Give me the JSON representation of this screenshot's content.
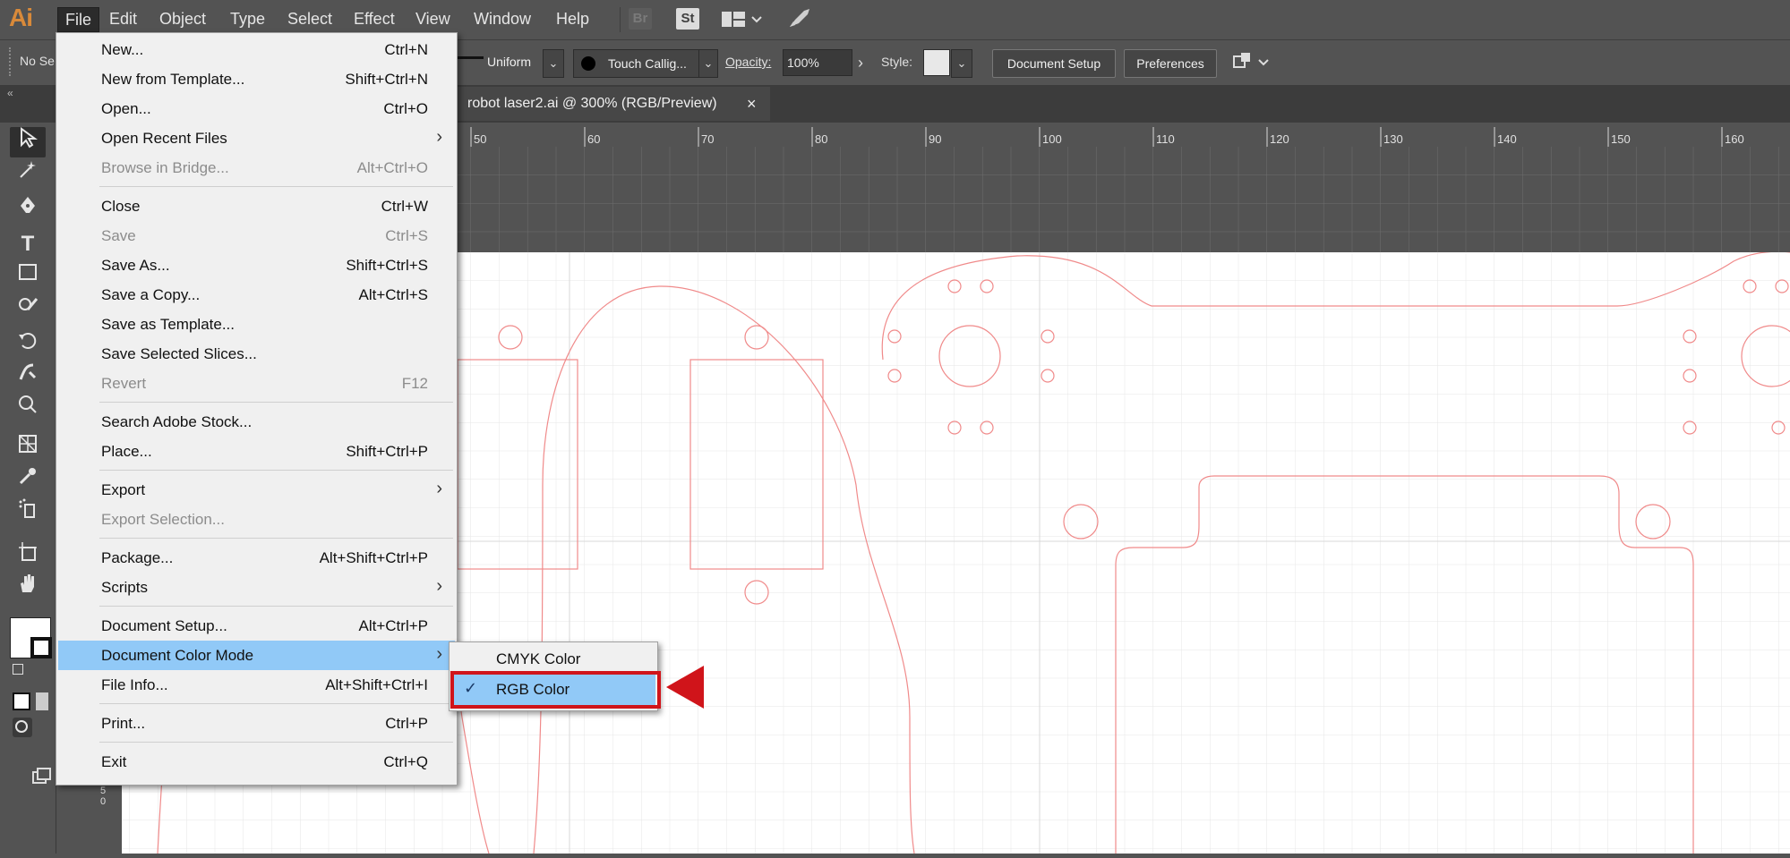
{
  "app": {
    "logo": "Ai"
  },
  "menubar": {
    "items": [
      "File",
      "Edit",
      "Object",
      "Type",
      "Select",
      "Effect",
      "View",
      "Window",
      "Help"
    ],
    "active": "File",
    "bridge_icon": "Br",
    "stock_icon": "St"
  },
  "controlbar": {
    "selection_label": "No Se",
    "stroke_profile": "Uniform",
    "brush": "Touch Callig...",
    "opacity_label": "Opacity:",
    "opacity_value": "100%",
    "style_label": "Style:",
    "document_setup_button": "Document Setup",
    "preferences_button": "Preferences"
  },
  "tab": {
    "title": "robot laser2.ai @ 300% (RGB/Preview)",
    "close": "×"
  },
  "ruler": {
    "ticks": [
      "50",
      "60",
      "70",
      "80",
      "90",
      "100",
      "110",
      "120",
      "130",
      "140",
      "150",
      "160"
    ],
    "vertical_label": "5 0"
  },
  "file_menu": {
    "items": [
      {
        "label": "New...",
        "shortcut": "Ctrl+N",
        "disabled": false,
        "submenu": false
      },
      {
        "label": "New from Template...",
        "shortcut": "Shift+Ctrl+N",
        "disabled": false,
        "submenu": false
      },
      {
        "label": "Open...",
        "shortcut": "Ctrl+O",
        "disabled": false,
        "submenu": false
      },
      {
        "label": "Open Recent Files",
        "shortcut": "",
        "disabled": false,
        "submenu": true
      },
      {
        "label": "Browse in Bridge...",
        "shortcut": "Alt+Ctrl+O",
        "disabled": true,
        "submenu": false
      },
      {
        "label": "Close",
        "shortcut": "Ctrl+W",
        "disabled": false,
        "submenu": false
      },
      {
        "label": "Save",
        "shortcut": "Ctrl+S",
        "disabled": true,
        "submenu": false
      },
      {
        "label": "Save As...",
        "shortcut": "Shift+Ctrl+S",
        "disabled": false,
        "submenu": false
      },
      {
        "label": "Save a Copy...",
        "shortcut": "Alt+Ctrl+S",
        "disabled": false,
        "submenu": false
      },
      {
        "label": "Save as Template...",
        "shortcut": "",
        "disabled": false,
        "submenu": false
      },
      {
        "label": "Save Selected Slices...",
        "shortcut": "",
        "disabled": false,
        "submenu": false
      },
      {
        "label": "Revert",
        "shortcut": "F12",
        "disabled": true,
        "submenu": false
      },
      {
        "label": "Search Adobe Stock...",
        "shortcut": "",
        "disabled": false,
        "submenu": false
      },
      {
        "label": "Place...",
        "shortcut": "Shift+Ctrl+P",
        "disabled": false,
        "submenu": false
      },
      {
        "label": "Export",
        "shortcut": "",
        "disabled": false,
        "submenu": true
      },
      {
        "label": "Export Selection...",
        "shortcut": "",
        "disabled": true,
        "submenu": false
      },
      {
        "label": "Package...",
        "shortcut": "Alt+Shift+Ctrl+P",
        "disabled": false,
        "submenu": false
      },
      {
        "label": "Scripts",
        "shortcut": "",
        "disabled": false,
        "submenu": true
      },
      {
        "label": "Document Setup...",
        "shortcut": "Alt+Ctrl+P",
        "disabled": false,
        "submenu": false
      },
      {
        "label": "Document Color Mode",
        "shortcut": "",
        "disabled": false,
        "submenu": true,
        "highlighted": true
      },
      {
        "label": "File Info...",
        "shortcut": "Alt+Shift+Ctrl+I",
        "disabled": false,
        "submenu": false
      },
      {
        "label": "Print...",
        "shortcut": "Ctrl+P",
        "disabled": false,
        "submenu": false
      },
      {
        "label": "Exit",
        "shortcut": "Ctrl+Q",
        "disabled": false,
        "submenu": false
      }
    ]
  },
  "color_mode_submenu": {
    "items": [
      {
        "label": "CMYK Color",
        "checked": false
      },
      {
        "label": "RGB Color",
        "checked": true,
        "highlighted": true
      }
    ]
  },
  "colors": {
    "accent_highlight": "#91c9f7",
    "callout_red": "#d0141a",
    "artwork_line": "#f08a8a"
  }
}
